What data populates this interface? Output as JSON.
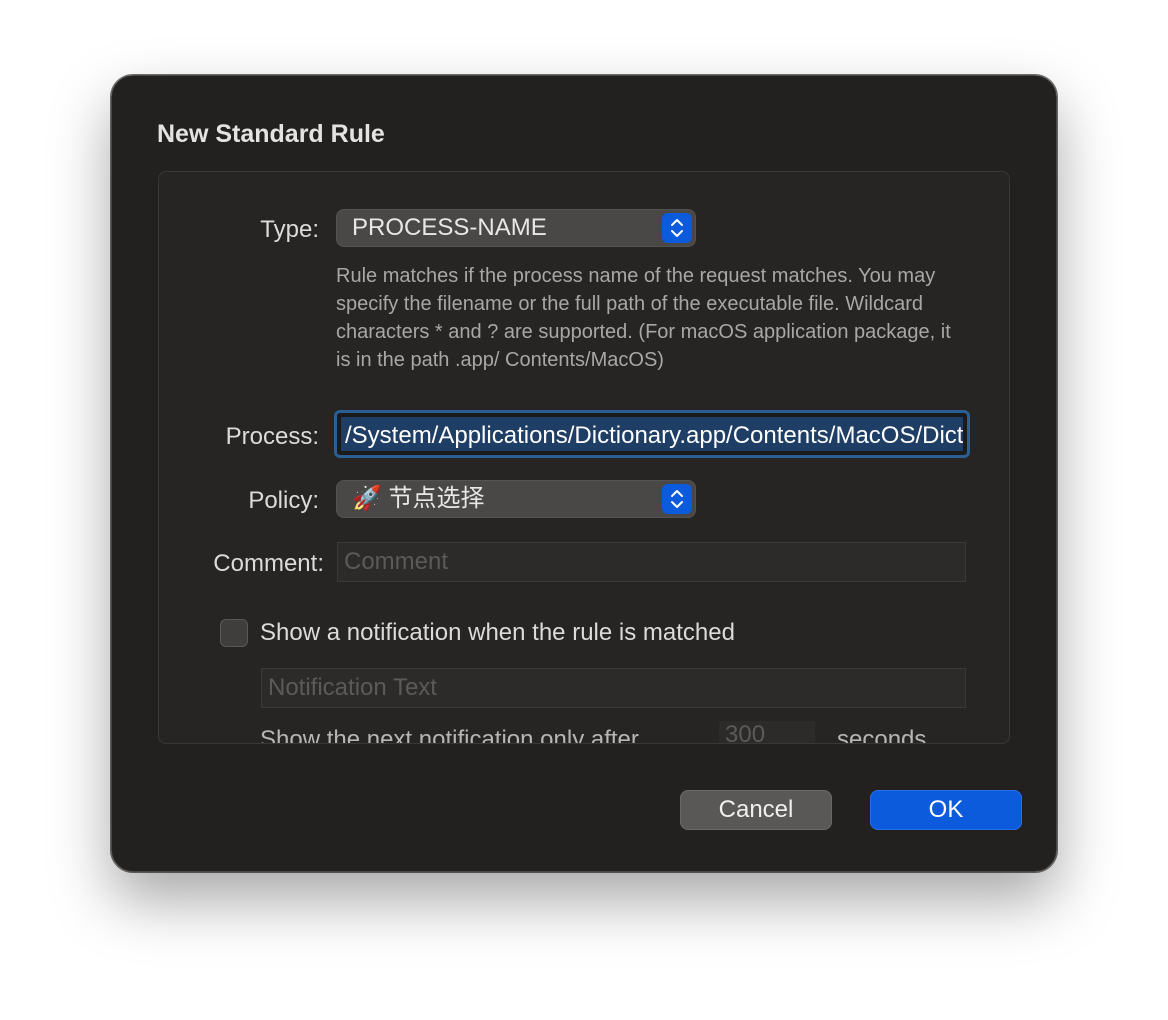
{
  "dialog": {
    "title": "New Standard Rule"
  },
  "form": {
    "type_label": "Type:",
    "type_value": "PROCESS-NAME",
    "type_description": "Rule matches if the process name of the request matches. You may specify the filename or the full path of the executable file. Wildcard characters * and ? are supported. (For macOS application package, it is in the path .app/ Contents/MacOS)",
    "process_label": "Process:",
    "process_value": "/System/Applications/Dictionary.app/Contents/MacOS/Dictionary",
    "policy_label": "Policy:",
    "policy_icon": "rocket-icon",
    "policy_value": "🚀 节点选择",
    "comment_label": "Comment:",
    "comment_placeholder": "Comment",
    "notification_checkbox_label": "Show a notification when the rule is matched",
    "notification_checked": false,
    "notification_text_placeholder": "Notification Text",
    "next_notification_label": "Show the next notification only after",
    "next_notification_seconds_placeholder": "300",
    "seconds_label": "seconds"
  },
  "buttons": {
    "cancel": "Cancel",
    "ok": "OK"
  },
  "colors": {
    "accent": "#0b5bdc",
    "dialog_bg": "#232120",
    "focus_ring": "#2a5f93"
  }
}
